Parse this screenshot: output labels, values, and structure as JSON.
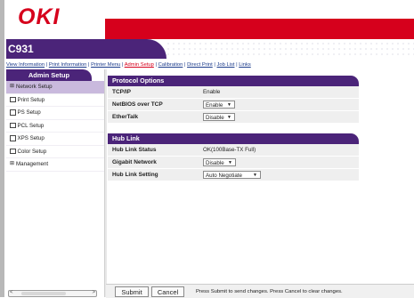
{
  "header": {
    "brand": "OKI",
    "model": "C931"
  },
  "colors": {
    "brand_red": "#d6001c",
    "accent_purple": "#4b2479",
    "selected_lavender": "#c9b9dd"
  },
  "top_links": [
    {
      "label": "View Information",
      "active": false
    },
    {
      "label": "Print Information",
      "active": false
    },
    {
      "label": "Printer Menu",
      "active": false
    },
    {
      "label": "Admin Setup",
      "active": true
    },
    {
      "label": "Calibration",
      "active": false
    },
    {
      "label": "Direct Print",
      "active": false
    },
    {
      "label": "Job List",
      "active": false
    },
    {
      "label": "Links",
      "active": false
    }
  ],
  "sidebar": {
    "title": "Admin Setup",
    "items": [
      {
        "label": "Network Setup",
        "marker": "plus"
      },
      {
        "label": "Print Setup",
        "marker": "box"
      },
      {
        "label": "PS Setup",
        "marker": "box"
      },
      {
        "label": "PCL Setup",
        "marker": "box"
      },
      {
        "label": "XPS Setup",
        "marker": "box"
      },
      {
        "label": "Color Setup",
        "marker": "box"
      },
      {
        "label": "Management",
        "marker": "plus"
      }
    ]
  },
  "protocol": {
    "title": "Protocol Options",
    "tcpip_label": "TCP/IP",
    "tcpip_value": "Enable",
    "netbios_label": "NetBIOS over TCP",
    "netbios_value": "Enable",
    "ethertalk_label": "EtherTalk",
    "ethertalk_value": "Disable"
  },
  "hublink": {
    "title": "Hub Link",
    "status_label": "Hub Link Status",
    "status_value": "OK(100Base-TX Full)",
    "gigabit_label": "Gigabit Network",
    "gigabit_value": "Disable",
    "setting_label": "Hub Link Setting",
    "setting_value": "Auto Negotiate"
  },
  "footer": {
    "submit_label": "Submit",
    "cancel_label": "Cancel",
    "hint": "Press Submit to send changes. Press Cancel to clear changes."
  },
  "icons": {
    "plus": "⊞",
    "box": "☐",
    "arrow": "▼",
    "scroll_left": "<",
    "scroll_right": ">"
  }
}
